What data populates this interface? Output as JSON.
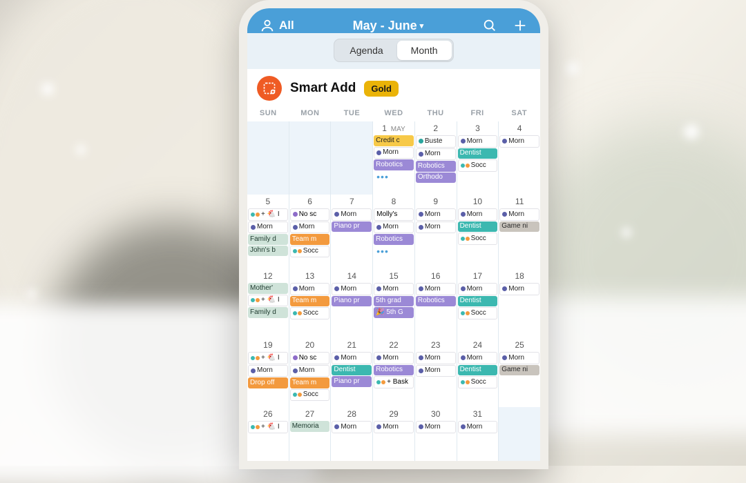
{
  "header": {
    "filter_label": "All",
    "title": "May - June",
    "caret": "▾"
  },
  "segmented": {
    "agenda": "Agenda",
    "month": "Month",
    "active": "month"
  },
  "smart_add": {
    "title": "Smart Add",
    "badge": "Gold"
  },
  "days_of_week": [
    "SUN",
    "MON",
    "TUE",
    "WED",
    "THU",
    "FRI",
    "SAT"
  ],
  "month_label_first_day": "MAY",
  "weeks": [
    {
      "cells": [
        {
          "blank": true
        },
        {
          "blank": true
        },
        {
          "blank": true
        },
        {
          "num": "1",
          "month": "MAY",
          "events": [
            {
              "cls": "c-credit",
              "text": "Credit c"
            },
            {
              "cls": "c-morn",
              "dot": true,
              "text": "Morn"
            },
            {
              "cls": "c-robot",
              "text": "Robotics"
            }
          ],
          "more": true
        },
        {
          "num": "2",
          "events": [
            {
              "cls": "c-buste",
              "dot": true,
              "text": "Buste"
            },
            {
              "cls": "c-morn",
              "dot": true,
              "text": "Morn"
            },
            {
              "cls": "c-robot",
              "text": "Robotics"
            },
            {
              "cls": "c-ortho",
              "text": "Orthodo"
            }
          ]
        },
        {
          "num": "3",
          "events": [
            {
              "cls": "c-morn",
              "dot": true,
              "text": "Morn"
            },
            {
              "cls": "c-dent",
              "text": "Dentist"
            },
            {
              "cls": "c-socc",
              "multidot": [
                "#3cb8b0",
                "#f39a3e"
              ],
              "text": "Socc"
            }
          ]
        },
        {
          "num": "4",
          "events": [
            {
              "cls": "c-morn",
              "dot": true,
              "text": "Morn"
            }
          ]
        }
      ]
    },
    {
      "cells": [
        {
          "num": "5",
          "events": [
            {
              "cls": "c-multi",
              "multidot": [
                "#3cb8b0",
                "#f39a3e"
              ],
              "text": "+ 🐔 I"
            },
            {
              "cls": "c-morn",
              "dot": true,
              "text": "Morn"
            },
            {
              "cls": "c-family",
              "text": "Family d"
            },
            {
              "cls": "c-john",
              "text": "John's b"
            }
          ]
        },
        {
          "num": "6",
          "events": [
            {
              "cls": "c-nosc",
              "dot": true,
              "text": "No sc"
            },
            {
              "cls": "c-morn",
              "dot": true,
              "text": "Morn"
            },
            {
              "cls": "c-team",
              "text": "Team m"
            },
            {
              "cls": "c-socc",
              "multidot": [
                "#3cb8b0",
                "#f39a3e"
              ],
              "text": "Socc"
            }
          ]
        },
        {
          "num": "7",
          "events": [
            {
              "cls": "c-morn",
              "dot": true,
              "text": "Morn"
            },
            {
              "cls": "c-piano",
              "text": "Piano pr"
            }
          ]
        },
        {
          "num": "8",
          "events": [
            {
              "cls": "c-molly",
              "text": "Molly's "
            },
            {
              "cls": "c-morn",
              "dot": true,
              "text": "Morn"
            },
            {
              "cls": "c-robot",
              "text": "Robotics"
            }
          ],
          "more": true
        },
        {
          "num": "9",
          "events": [
            {
              "cls": "c-morn",
              "dot": true,
              "text": "Morn"
            },
            {
              "cls": "c-morn",
              "dot": true,
              "text": "Morn"
            }
          ]
        },
        {
          "num": "10",
          "events": [
            {
              "cls": "c-morn",
              "dot": true,
              "text": "Morn"
            },
            {
              "cls": "c-dent",
              "text": "Dentist"
            },
            {
              "cls": "c-socc",
              "multidot": [
                "#3cb8b0",
                "#f39a3e"
              ],
              "text": "Socc"
            }
          ]
        },
        {
          "num": "11",
          "events": [
            {
              "cls": "c-morn",
              "dot": true,
              "text": "Morn"
            },
            {
              "cls": "c-game",
              "text": "Game ni"
            }
          ]
        }
      ]
    },
    {
      "cells": [
        {
          "num": "12",
          "events": [
            {
              "cls": "c-moth",
              "text": "Mother'"
            },
            {
              "cls": "c-multi",
              "multidot": [
                "#3cb8b0",
                "#f39a3e"
              ],
              "text": "+ 🐔 I"
            },
            {
              "cls": "c-family",
              "text": "Family d"
            }
          ]
        },
        {
          "num": "13",
          "events": [
            {
              "cls": "c-morn",
              "dot": true,
              "text": "Morn"
            },
            {
              "cls": "c-team",
              "text": "Team m"
            },
            {
              "cls": "c-socc",
              "multidot": [
                "#3cb8b0",
                "#f39a3e"
              ],
              "text": "Socc"
            }
          ]
        },
        {
          "num": "14",
          "events": [
            {
              "cls": "c-morn",
              "dot": true,
              "text": "Morn"
            },
            {
              "cls": "c-piano",
              "text": "Piano pr"
            }
          ]
        },
        {
          "num": "15",
          "events": [
            {
              "cls": "c-morn",
              "dot": true,
              "text": "Morn"
            },
            {
              "cls": "c-5g",
              "text": "5th grad"
            },
            {
              "cls": "c-5g",
              "text": "🎉 5th G"
            }
          ]
        },
        {
          "num": "16",
          "events": [
            {
              "cls": "c-morn",
              "dot": true,
              "text": "Morn"
            },
            {
              "cls": "c-robot",
              "text": "Robotics"
            }
          ]
        },
        {
          "num": "17",
          "events": [
            {
              "cls": "c-morn",
              "dot": true,
              "text": "Morn"
            },
            {
              "cls": "c-dent",
              "text": "Dentist"
            },
            {
              "cls": "c-socc",
              "multidot": [
                "#3cb8b0",
                "#f39a3e"
              ],
              "text": "Socc"
            }
          ]
        },
        {
          "num": "18",
          "events": [
            {
              "cls": "c-morn",
              "dot": true,
              "text": "Morn"
            }
          ]
        }
      ]
    },
    {
      "cells": [
        {
          "num": "19",
          "events": [
            {
              "cls": "c-multi",
              "multidot": [
                "#3cb8b0",
                "#f39a3e"
              ],
              "text": "+ 🐔 I"
            },
            {
              "cls": "c-morn",
              "dot": true,
              "text": "Morn"
            },
            {
              "cls": "c-drop",
              "text": "Drop off"
            }
          ]
        },
        {
          "num": "20",
          "events": [
            {
              "cls": "c-nosc",
              "dot": true,
              "text": "No sc"
            },
            {
              "cls": "c-morn",
              "dot": true,
              "text": "Morn"
            },
            {
              "cls": "c-team",
              "text": "Team m"
            },
            {
              "cls": "c-socc",
              "multidot": [
                "#3cb8b0",
                "#f39a3e"
              ],
              "text": "Socc"
            }
          ]
        },
        {
          "num": "21",
          "events": [
            {
              "cls": "c-morn",
              "dot": true,
              "text": "Morn"
            },
            {
              "cls": "c-dent",
              "text": "Dentist"
            },
            {
              "cls": "c-piano",
              "text": "Piano pr"
            }
          ]
        },
        {
          "num": "22",
          "events": [
            {
              "cls": "c-morn",
              "dot": true,
              "text": "Morn"
            },
            {
              "cls": "c-robot",
              "text": "Robotics"
            },
            {
              "cls": "c-bask",
              "multidot": [
                "#3cb8b0",
                "#f39a3e"
              ],
              "text": "+ Bask"
            }
          ]
        },
        {
          "num": "23",
          "events": [
            {
              "cls": "c-morn",
              "dot": true,
              "text": "Morn"
            },
            {
              "cls": "c-morn",
              "dot": true,
              "text": "Morn"
            }
          ]
        },
        {
          "num": "24",
          "events": [
            {
              "cls": "c-morn",
              "dot": true,
              "text": "Morn"
            },
            {
              "cls": "c-dent",
              "text": "Dentist"
            },
            {
              "cls": "c-socc",
              "multidot": [
                "#3cb8b0",
                "#f39a3e"
              ],
              "text": "Socc"
            }
          ]
        },
        {
          "num": "25",
          "events": [
            {
              "cls": "c-morn",
              "dot": true,
              "text": "Morn"
            },
            {
              "cls": "c-game",
              "text": "Game ni"
            }
          ]
        }
      ]
    },
    {
      "cells": [
        {
          "num": "26",
          "events": [
            {
              "cls": "c-multi",
              "multidot": [
                "#3cb8b0",
                "#f39a3e"
              ],
              "text": "+ 🐔 I"
            }
          ]
        },
        {
          "num": "27",
          "events": [
            {
              "cls": "c-memo",
              "text": "Memoria"
            }
          ]
        },
        {
          "num": "28",
          "events": [
            {
              "cls": "c-morn",
              "dot": true,
              "text": "Morn"
            }
          ]
        },
        {
          "num": "29",
          "events": [
            {
              "cls": "c-morn",
              "dot": true,
              "text": "Morn"
            }
          ]
        },
        {
          "num": "30",
          "events": [
            {
              "cls": "c-morn",
              "dot": true,
              "text": "Morn"
            }
          ]
        },
        {
          "num": "31",
          "events": [
            {
              "cls": "c-morn",
              "dot": true,
              "text": "Morn"
            }
          ]
        },
        {
          "blank": true
        }
      ]
    }
  ]
}
